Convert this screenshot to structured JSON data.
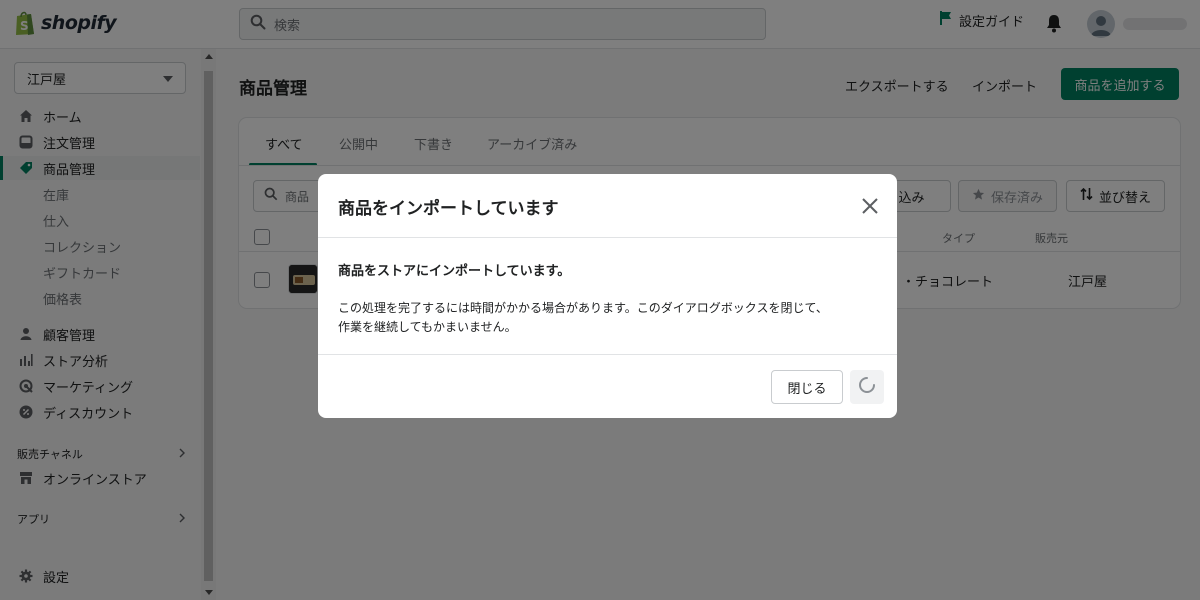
{
  "brand": {
    "name": "shopify",
    "accent": "#008060"
  },
  "search": {
    "placeholder": "検索"
  },
  "header": {
    "setup_guide": "設定ガイド"
  },
  "sidebar": {
    "store": "江戸屋",
    "items": [
      {
        "label": "ホーム",
        "icon": "home-icon"
      },
      {
        "label": "注文管理",
        "icon": "orders-icon"
      },
      {
        "label": "商品管理",
        "icon": "tag-icon",
        "active": true
      },
      {
        "label": "在庫"
      },
      {
        "label": "仕入"
      },
      {
        "label": "コレクション"
      },
      {
        "label": "ギフトカード"
      },
      {
        "label": "価格表"
      },
      {
        "label": "顧客管理",
        "icon": "person-icon"
      },
      {
        "label": "ストア分析",
        "icon": "bar-chart-icon"
      },
      {
        "label": "マーケティング",
        "icon": "target-icon"
      },
      {
        "label": "ディスカウント",
        "icon": "discount-icon"
      }
    ],
    "sales_channels": "販売チャネル",
    "online_store": "オンラインストア",
    "apps": "アプリ",
    "settings": "設定"
  },
  "main": {
    "title": "商品管理",
    "export": "エクスポートする",
    "import": "インポート",
    "add_product": "商品を追加する",
    "tabs": [
      "すべて",
      "公開中",
      "下書き",
      "アーカイブ済み"
    ],
    "filter_placeholder": "商品",
    "filter_button": "り込み",
    "saved_button": "保存済み",
    "sort_button": "並び替え",
    "columns": {
      "type": "タイプ",
      "vendor": "販売元"
    },
    "row": {
      "type": "・チョコレート",
      "vendor": "江戸屋"
    }
  },
  "modal": {
    "title": "商品をインポートしています",
    "heading": "商品をストアにインポートしています。",
    "body_line1": "この処理を完了するには時間がかかる場合があります。このダイアログボックスを閉じて、",
    "body_line2": "作業を継続してもかまいません。",
    "close": "閉じる"
  }
}
